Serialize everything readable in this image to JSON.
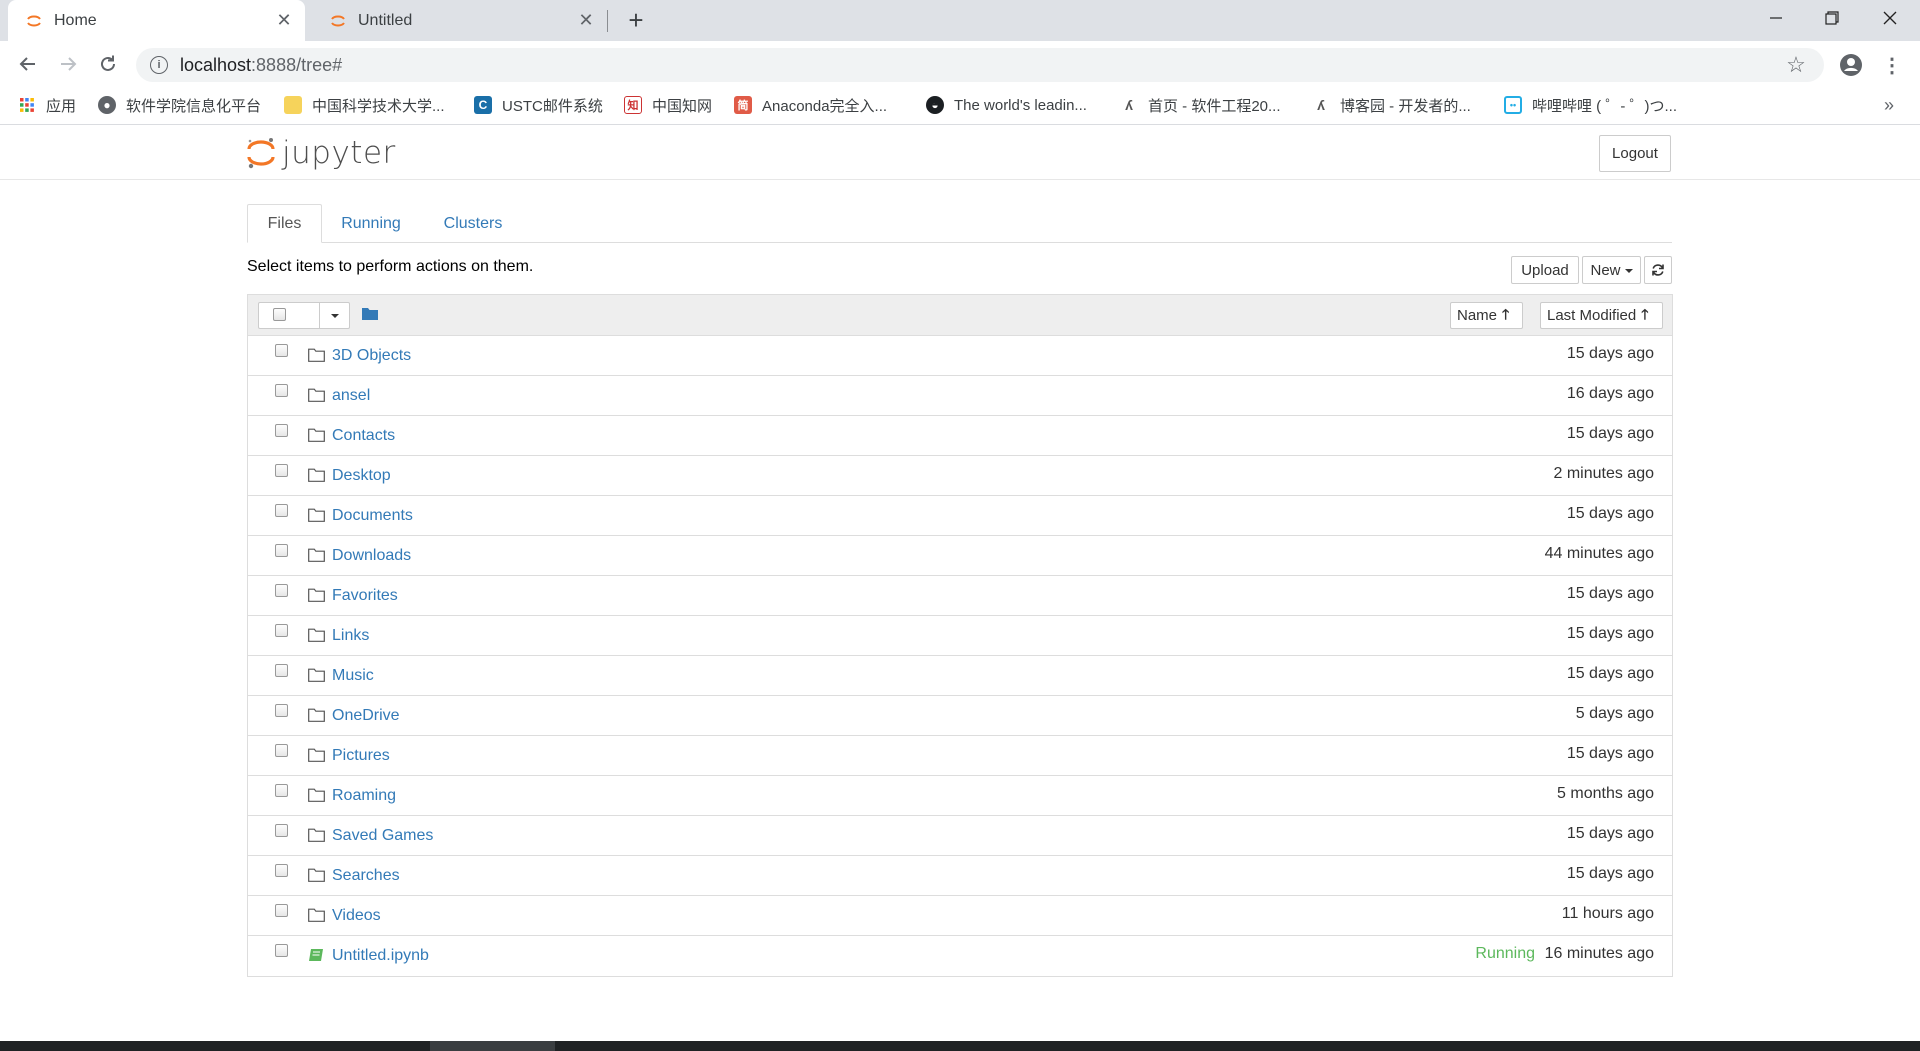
{
  "browser": {
    "tabs": [
      {
        "title": "Home",
        "active": true
      },
      {
        "title": "Untitled",
        "active": false
      }
    ],
    "address": {
      "host": "localhost",
      "path": ":8888/tree#"
    },
    "bookmarks": [
      {
        "label": "应用",
        "icon": "apps-grid-icon"
      },
      {
        "label": "软件学院信息化平台",
        "icon": "globe-icon"
      },
      {
        "label": "中国科学技术大学...",
        "icon": "ustc-icon"
      },
      {
        "label": "USTC邮件系统",
        "icon": "c-mail-icon"
      },
      {
        "label": "中国知网",
        "icon": "cnki-icon"
      },
      {
        "label": "Anaconda完全入...",
        "icon": "jianshu-icon"
      },
      {
        "label": "The world's leadin...",
        "icon": "github-icon"
      },
      {
        "label": "首页 - 软件工程20...",
        "icon": "ustc-swan-icon"
      },
      {
        "label": "博客园 - 开发者的...",
        "icon": "cnblogs-icon"
      },
      {
        "label": "哔哩哔哩 ( ゜- ゜)つ...",
        "icon": "bilibili-icon"
      }
    ]
  },
  "jupyter": {
    "logo_text": "jupyter",
    "logout_label": "Logout",
    "tabs": [
      "Files",
      "Running",
      "Clusters"
    ],
    "hint": "Select items to perform actions on them.",
    "upload_label": "Upload",
    "new_label": "New",
    "sort_name_label": "Name",
    "sort_modified_label": "Last Modified",
    "running_label": "Running",
    "files": [
      {
        "name": "3D Objects",
        "type": "folder",
        "modified": "15 days ago"
      },
      {
        "name": "ansel",
        "type": "folder",
        "modified": "16 days ago"
      },
      {
        "name": "Contacts",
        "type": "folder",
        "modified": "15 days ago"
      },
      {
        "name": "Desktop",
        "type": "folder",
        "modified": "2 minutes ago"
      },
      {
        "name": "Documents",
        "type": "folder",
        "modified": "15 days ago"
      },
      {
        "name": "Downloads",
        "type": "folder",
        "modified": "44 minutes ago"
      },
      {
        "name": "Favorites",
        "type": "folder",
        "modified": "15 days ago"
      },
      {
        "name": "Links",
        "type": "folder",
        "modified": "15 days ago"
      },
      {
        "name": "Music",
        "type": "folder",
        "modified": "15 days ago"
      },
      {
        "name": "OneDrive",
        "type": "folder",
        "modified": "5 days ago"
      },
      {
        "name": "Pictures",
        "type": "folder",
        "modified": "15 days ago"
      },
      {
        "name": "Roaming",
        "type": "folder",
        "modified": "5 months ago"
      },
      {
        "name": "Saved Games",
        "type": "folder",
        "modified": "15 days ago"
      },
      {
        "name": "Searches",
        "type": "folder",
        "modified": "15 days ago"
      },
      {
        "name": "Videos",
        "type": "folder",
        "modified": "11 hours ago"
      },
      {
        "name": "Untitled.ipynb",
        "type": "notebook",
        "modified": "16 minutes ago",
        "running": true
      }
    ]
  },
  "colors": {
    "link": "#337ab7",
    "running": "#5cb85c",
    "jupyter_orange": "#f37726"
  }
}
